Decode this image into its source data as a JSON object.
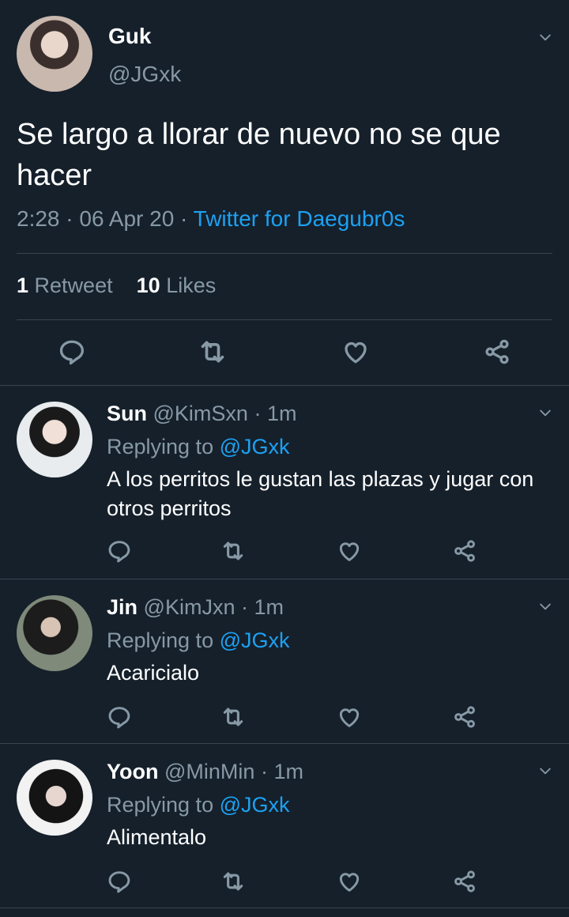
{
  "main_tweet": {
    "name": "Guk",
    "handle": "@JGxk",
    "text": "Se largo a llorar de nuevo no se que hacer",
    "time": "2:28",
    "date": "06 Apr 20",
    "source": "Twitter for Daegubr0s",
    "retweet_count": "1",
    "retweet_label": "Retweet",
    "like_count": "10",
    "like_label": "Likes"
  },
  "replies": [
    {
      "name": "Sun",
      "handle": "@KimSxn",
      "time": "1m",
      "replying_label": "Replying to",
      "replying_to": "@JGxk",
      "text": "A los perritos le gustan las plazas y jugar con otros perritos"
    },
    {
      "name": "Jin",
      "handle": "@KimJxn",
      "time": "1m",
      "replying_label": "Replying to",
      "replying_to": "@JGxk",
      "text": "Acaricialo"
    },
    {
      "name": "Yoon",
      "handle": "@MinMin",
      "time": "1m",
      "replying_label": "Replying to",
      "replying_to": "@JGxk",
      "text": "Alimentalo"
    }
  ],
  "separator": "·",
  "icons": [
    "chevron-down-icon",
    "reply-icon",
    "retweet-icon",
    "like-icon",
    "share-icon"
  ],
  "colors": {
    "background": "#15202b",
    "text": "#ffffff",
    "secondary": "#8899a6",
    "accent": "#1da1f2",
    "divider": "#38444d"
  }
}
